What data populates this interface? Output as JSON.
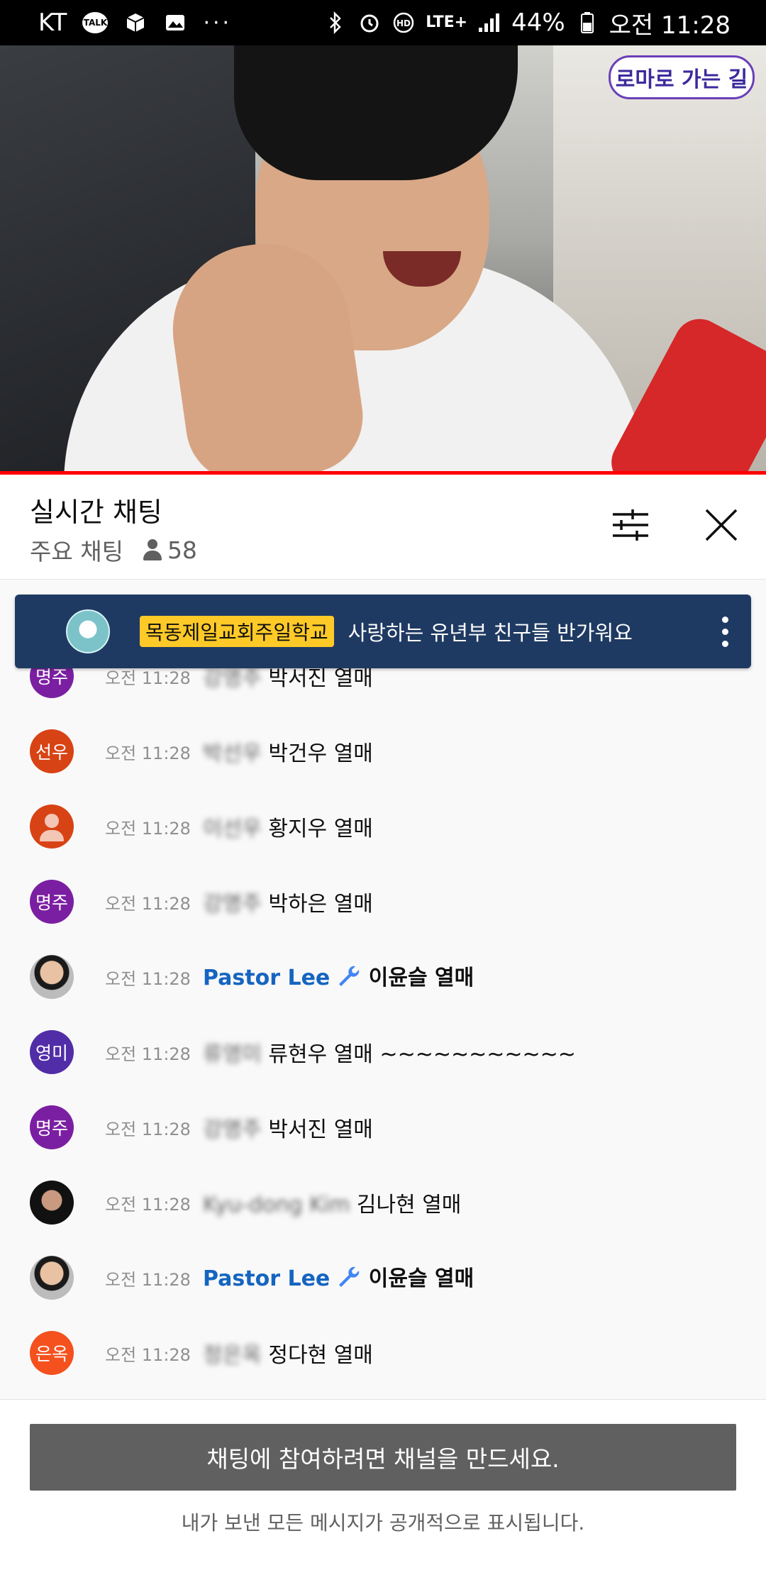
{
  "status_bar": {
    "carrier": "KT",
    "talk_label": "TALK",
    "overflow": "···",
    "network": "LTE+",
    "battery": "44%",
    "clock": "오전 11:28"
  },
  "video": {
    "channel_logo_text": "로마로 가는 길",
    "progress_fraction": 1.0,
    "progress_color": "#ff0000"
  },
  "chat_header": {
    "title": "실시간 채팅",
    "mode": "주요 채팅",
    "viewer_count": "58"
  },
  "pinned": {
    "author": "목동제일교회주일학교",
    "message": "사랑하는 유년부 친구들 반가워요",
    "background": "#1f3a62",
    "author_chip_color": "#ffca28"
  },
  "messages": [
    {
      "avatar_text": "명주",
      "avatar_color": "#7b1fa2",
      "time": "오전 11:28",
      "author": "강명주",
      "moderator": false,
      "text": "박서진 열매"
    },
    {
      "avatar_text": "선우",
      "avatar_color": "#d84315",
      "time": "오전 11:28",
      "author": "박선우",
      "moderator": false,
      "text": "박건우 열매"
    },
    {
      "avatar_text": "",
      "avatar_color": "#d84315",
      "avatar_kind": "default-person-icon",
      "time": "오전 11:28",
      "author": "이선우",
      "moderator": false,
      "text": "황지우 열매"
    },
    {
      "avatar_text": "명주",
      "avatar_color": "#7b1fa2",
      "time": "오전 11:28",
      "author": "강명주",
      "moderator": false,
      "text": "박하은 열매"
    },
    {
      "avatar_text": "",
      "avatar_kind": "photo",
      "time": "오전 11:28",
      "author": "Pastor Lee",
      "moderator": true,
      "text": "이윤슬 열매"
    },
    {
      "avatar_text": "영미",
      "avatar_color": "#512da8",
      "time": "오전 11:28",
      "author": "류영미",
      "moderator": false,
      "text": "류현우 열매 ~~~~~~~~~~~"
    },
    {
      "avatar_text": "명주",
      "avatar_color": "#7b1fa2",
      "time": "오전 11:28",
      "author": "강명주",
      "moderator": false,
      "text": "박서진 열매"
    },
    {
      "avatar_text": "",
      "avatar_kind": "photo",
      "time": "오전 11:28",
      "author": "Kyu-dong Kim",
      "moderator": false,
      "text": "김나현 열매"
    },
    {
      "avatar_text": "",
      "avatar_kind": "photo",
      "time": "오전 11:28",
      "author": "Pastor Lee",
      "moderator": true,
      "text": "이윤슬 열매"
    },
    {
      "avatar_text": "은옥",
      "avatar_color": "#f4511e",
      "time": "오전 11:28",
      "author": "정은옥",
      "moderator": false,
      "text": "정다현 열매"
    }
  ],
  "bottom": {
    "create_channel_label": "채팅에 참여하려면 채널을 만드세요.",
    "disclaimer": "내가 보낸 모든 메시지가 공개적으로 표시됩니다."
  },
  "icons": {
    "filter": "sliders-icon",
    "close": "close-icon",
    "pinned_more": "more-vert-icon",
    "moderator_badge": "wrench-icon",
    "viewer": "person-icon"
  }
}
